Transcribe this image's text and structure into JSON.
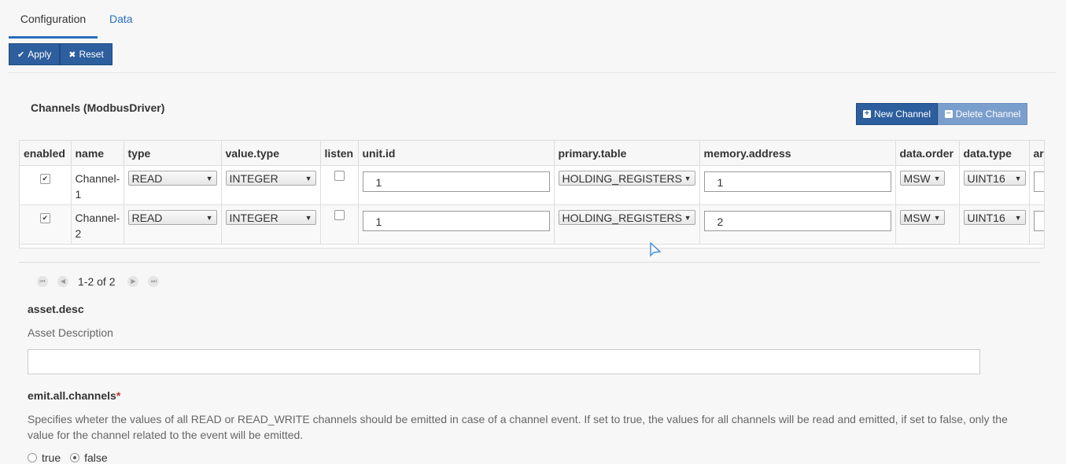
{
  "tabs": {
    "configuration": "Configuration",
    "data": "Data"
  },
  "toolbar": {
    "apply": "Apply",
    "reset": "Reset"
  },
  "channels": {
    "title": "Channels (ModbusDriver)",
    "new_channel": "New Channel",
    "delete_channel": "Delete Channel",
    "columns": [
      "enabled",
      "name",
      "type",
      "value.type",
      "listen",
      "unit.id",
      "primary.table",
      "memory.address",
      "data.order",
      "data.type",
      "ar"
    ],
    "rows": [
      {
        "enabled": true,
        "name": "Channel-1",
        "type": "READ",
        "value_type": "INTEGER",
        "listen": false,
        "unit_id": "1",
        "primary_table": "HOLDING_REGISTERS",
        "memory_address": "1",
        "data_order": "MSW",
        "data_type": "UINT16"
      },
      {
        "enabled": true,
        "name": "Channel-2",
        "type": "READ",
        "value_type": "INTEGER",
        "listen": false,
        "unit_id": "1",
        "primary_table": "HOLDING_REGISTERS",
        "memory_address": "2",
        "data_order": "MSW",
        "data_type": "UINT16"
      }
    ],
    "pager": "1-2 of 2"
  },
  "asset_desc": {
    "label": "asset.desc",
    "description": "Asset Description",
    "value": ""
  },
  "emit_all": {
    "label": "emit.all.channels",
    "required_mark": "*",
    "description": "Specifies wheter the values of all READ or READ_WRITE channels should be emitted in case of a channel event. If set to true, the values for all channels will be read and emitted, if set to false, only the value for the channel related to the event will be emitted.",
    "options": [
      "true",
      "false"
    ],
    "selected": "false"
  },
  "colors": {
    "primary": "#2d5e9e",
    "link": "#2a6ebb",
    "disabled": "#7b9fcc"
  }
}
